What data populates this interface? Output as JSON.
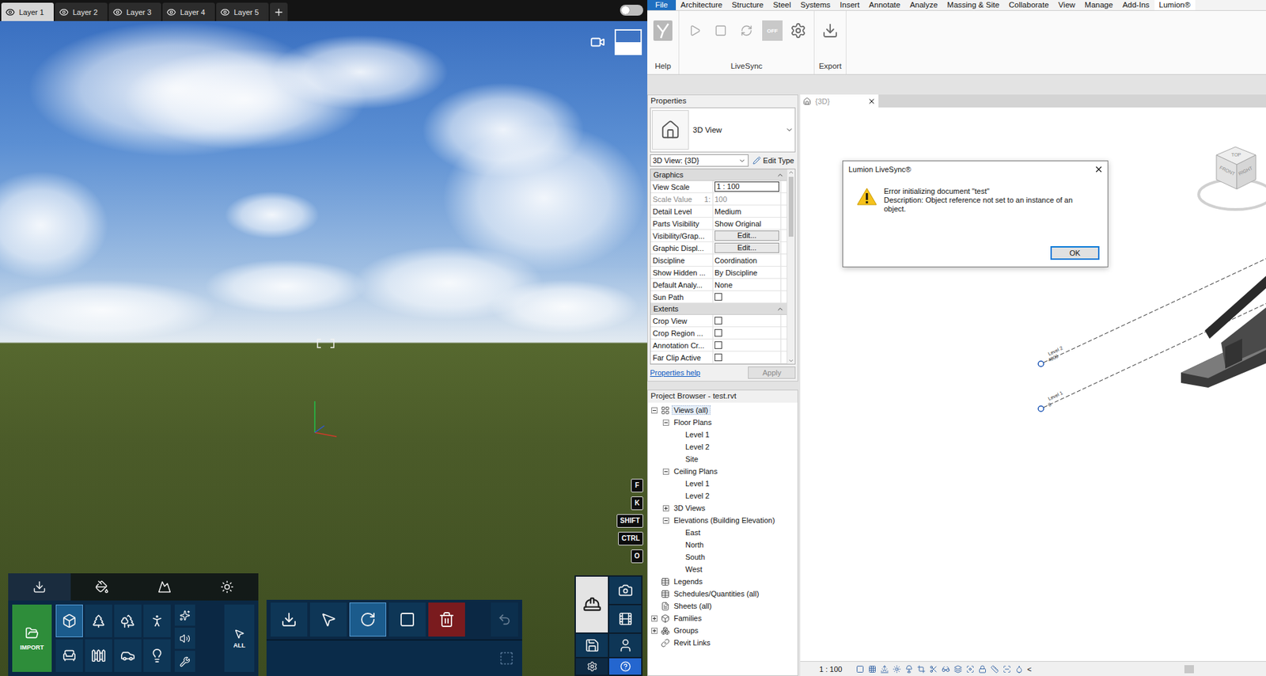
{
  "lumion": {
    "layers": [
      {
        "label": "Layer 1",
        "selected": true,
        "visible": true
      },
      {
        "label": "Layer 2",
        "selected": false,
        "visible": true
      },
      {
        "label": "Layer 3",
        "selected": false,
        "visible": true
      },
      {
        "label": "Layer 4",
        "selected": false,
        "visible": true
      },
      {
        "label": "Layer 5",
        "selected": false,
        "visible": true
      }
    ],
    "live_toggle": {
      "on": false
    },
    "keys": [
      "F",
      "K",
      "SHIFT",
      "CTRL",
      "O"
    ],
    "categories": [
      {
        "kind": "import",
        "selected": true
      },
      {
        "kind": "materials",
        "selected": false
      },
      {
        "kind": "landscape",
        "selected": false
      },
      {
        "kind": "weather",
        "selected": false
      }
    ],
    "import_label": "IMPORT",
    "object_types": [
      {
        "kind": "model",
        "selected": true
      },
      {
        "kind": "tree",
        "selected": false
      },
      {
        "kind": "nature",
        "selected": false
      },
      {
        "kind": "people",
        "selected": false
      },
      {
        "kind": "furniture",
        "selected": false
      },
      {
        "kind": "fence",
        "selected": false
      },
      {
        "kind": "car",
        "selected": false
      },
      {
        "kind": "light",
        "selected": false
      }
    ],
    "extra_types": [
      {
        "kind": "effects",
        "selected": false
      },
      {
        "kind": "sound",
        "selected": false
      },
      {
        "kind": "utilities",
        "selected": false
      }
    ],
    "all_label": "ALL",
    "edit_tools": [
      {
        "kind": "place",
        "selected": false
      },
      {
        "kind": "select",
        "selected": false
      },
      {
        "kind": "rotate",
        "selected": true
      },
      {
        "kind": "scale",
        "selected": false
      },
      {
        "kind": "delete",
        "selected": false
      }
    ],
    "undo": {
      "disabled": true
    },
    "modes": [
      {
        "kind": "build",
        "selected": true
      },
      {
        "kind": "photo",
        "selected": false
      },
      {
        "kind": "movie",
        "selected": false
      },
      {
        "kind": "save",
        "selected": false
      },
      {
        "kind": "panorama",
        "selected": false
      }
    ]
  },
  "revit": {
    "tabs": [
      {
        "label": "File",
        "kind": "file",
        "selected": false
      },
      {
        "label": "Architecture",
        "kind": "tab",
        "selected": false
      },
      {
        "label": "Structure",
        "kind": "tab",
        "selected": false
      },
      {
        "label": "Steel",
        "kind": "tab",
        "selected": false
      },
      {
        "label": "Systems",
        "kind": "tab",
        "selected": false
      },
      {
        "label": "Insert",
        "kind": "tab",
        "selected": false
      },
      {
        "label": "Annotate",
        "kind": "tab",
        "selected": false
      },
      {
        "label": "Analyze",
        "kind": "tab",
        "selected": false
      },
      {
        "label": "Massing & Site",
        "kind": "tab",
        "selected": false
      },
      {
        "label": "Collaborate",
        "kind": "tab",
        "selected": false
      },
      {
        "label": "View",
        "kind": "tab",
        "selected": false
      },
      {
        "label": "Manage",
        "kind": "tab",
        "selected": false
      },
      {
        "label": "Add-Ins",
        "kind": "tab",
        "selected": false
      },
      {
        "label": "Lumion®",
        "kind": "tab",
        "selected": true
      }
    ],
    "ribbon_groups": [
      {
        "label": "Help",
        "tools": [
          {
            "kind": "help",
            "disabled": false
          }
        ]
      },
      {
        "label": "LiveSync",
        "tools": [
          {
            "kind": "play",
            "disabled": true
          },
          {
            "kind": "stop",
            "disabled": true
          },
          {
            "kind": "sync",
            "disabled": true
          },
          {
            "kind": "off",
            "label": "OFF",
            "disabled": true
          },
          {
            "kind": "settings",
            "disabled": false
          }
        ]
      },
      {
        "label": "Export",
        "tools": [
          {
            "kind": "export",
            "disabled": false
          }
        ]
      }
    ],
    "properties": {
      "title": "Properties",
      "type_name": "3D View",
      "selector": "3D View: {3D}",
      "edit_type": "Edit Type",
      "sections": [
        {
          "title": "Graphics",
          "expanded": true,
          "rows": [
            {
              "label": "View Scale",
              "kind": "input",
              "value": "1 : 100"
            },
            {
              "label": "Scale Value",
              "prefix": "1:",
              "kind": "readonly",
              "value": "100"
            },
            {
              "label": "Detail Level",
              "kind": "text",
              "value": "Medium"
            },
            {
              "label": "Parts Visibility",
              "kind": "text",
              "value": "Show Original"
            },
            {
              "label": "Visibility/Grap...",
              "kind": "button",
              "value": "Edit..."
            },
            {
              "label": "Graphic Displ...",
              "kind": "button",
              "value": "Edit..."
            },
            {
              "label": "Discipline",
              "kind": "text",
              "value": "Coordination"
            },
            {
              "label": "Show Hidden ...",
              "kind": "text",
              "value": "By Discipline"
            },
            {
              "label": "Default Analy...",
              "kind": "text",
              "value": "None"
            },
            {
              "label": "Sun Path",
              "kind": "checkbox",
              "checked": false
            }
          ]
        },
        {
          "title": "Extents",
          "expanded": true,
          "rows": [
            {
              "label": "Crop View",
              "kind": "checkbox",
              "checked": false
            },
            {
              "label": "Crop Region ...",
              "kind": "checkbox",
              "checked": false
            },
            {
              "label": "Annotation Cr...",
              "kind": "checkbox",
              "checked": false
            },
            {
              "label": "Far Clip Active",
              "kind": "checkbox",
              "checked": false
            }
          ]
        }
      ],
      "help_link": "Properties help",
      "apply": {
        "label": "Apply",
        "disabled": true
      }
    },
    "browser": {
      "title": "Project Browser - test.rvt",
      "items": [
        {
          "label": "Views (all)",
          "depth": 0,
          "kind": "views",
          "expandable": true,
          "expanded": true,
          "selected": true
        },
        {
          "label": "Floor Plans",
          "depth": 1,
          "kind": "folder",
          "expandable": true,
          "expanded": true,
          "selected": false
        },
        {
          "label": "Level 1",
          "depth": 2,
          "kind": "leaf",
          "expandable": false,
          "expanded": false,
          "selected": false
        },
        {
          "label": "Level 2",
          "depth": 2,
          "kind": "leaf",
          "expandable": false,
          "expanded": false,
          "selected": false
        },
        {
          "label": "Site",
          "depth": 2,
          "kind": "leaf",
          "expandable": false,
          "expanded": false,
          "selected": false
        },
        {
          "label": "Ceiling Plans",
          "depth": 1,
          "kind": "folder",
          "expandable": true,
          "expanded": true,
          "selected": false
        },
        {
          "label": "Level 1",
          "depth": 2,
          "kind": "leaf",
          "expandable": false,
          "expanded": false,
          "selected": false
        },
        {
          "label": "Level 2",
          "depth": 2,
          "kind": "leaf",
          "expandable": false,
          "expanded": false,
          "selected": false
        },
        {
          "label": "3D Views",
          "depth": 1,
          "kind": "folder",
          "expandable": true,
          "expanded": false,
          "selected": false
        },
        {
          "label": "Elevations (Building Elevation)",
          "depth": 1,
          "kind": "folder",
          "expandable": true,
          "expanded": true,
          "selected": false
        },
        {
          "label": "East",
          "depth": 2,
          "kind": "leaf",
          "expandable": false,
          "expanded": false,
          "selected": false
        },
        {
          "label": "North",
          "depth": 2,
          "kind": "leaf",
          "expandable": false,
          "expanded": false,
          "selected": false
        },
        {
          "label": "South",
          "depth": 2,
          "kind": "leaf",
          "expandable": false,
          "expanded": false,
          "selected": false
        },
        {
          "label": "West",
          "depth": 2,
          "kind": "leaf",
          "expandable": false,
          "expanded": false,
          "selected": false
        },
        {
          "label": "Legends",
          "depth": 0,
          "kind": "legends",
          "expandable": false,
          "expanded": false,
          "selected": false
        },
        {
          "label": "Schedules/Quantities (all)",
          "depth": 0,
          "kind": "schedules",
          "expandable": false,
          "expanded": false,
          "selected": false
        },
        {
          "label": "Sheets (all)",
          "depth": 0,
          "kind": "sheets",
          "expandable": false,
          "expanded": false,
          "selected": false
        },
        {
          "label": "Families",
          "depth": 0,
          "kind": "families",
          "expandable": true,
          "expanded": false,
          "selected": false
        },
        {
          "label": "Groups",
          "depth": 0,
          "kind": "groups",
          "expandable": true,
          "expanded": false,
          "selected": false
        },
        {
          "label": "Revit Links",
          "depth": 0,
          "kind": "links",
          "expandable": false,
          "expanded": false,
          "selected": false
        }
      ]
    },
    "view": {
      "tab": "{3D}",
      "levels": [
        {
          "label": "Level 2",
          "elevation": "4000"
        },
        {
          "label": "Level 1",
          "elevation": "0"
        }
      ],
      "viewcube": [
        "TOP",
        "FRONT",
        "RIGHT"
      ],
      "dialog": {
        "title": "Lumion LiveSync®",
        "lines": [
          "Error initializing document \"test\"",
          "Description: Object reference not set to an instance of an",
          "object."
        ],
        "button": "OK"
      }
    },
    "status": {
      "scale": "1 : 100",
      "scroll_left": "<"
    }
  }
}
